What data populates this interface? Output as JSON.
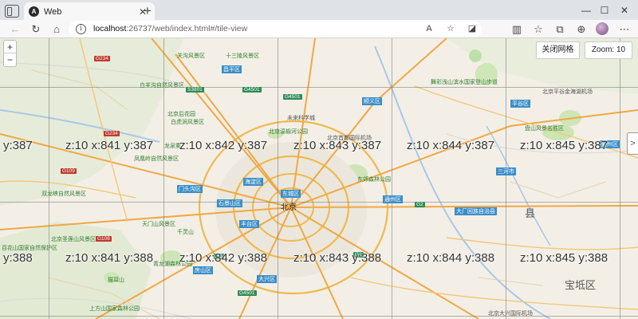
{
  "browser": {
    "tab": {
      "title": "Web",
      "favicon_letter": "A"
    },
    "address": {
      "host": "localhost",
      "rest": ":26737/web/index.html#/tile-view"
    },
    "reader_label": "A"
  },
  "map": {
    "controls": {
      "zoom_in": "+",
      "zoom_out": "−"
    },
    "grid_button": "关闭网格",
    "zoom_badge": "Zoom: 10",
    "tiles": [
      {
        "text": "y:387"
      },
      {
        "text": "z:10 x:841 y:387"
      },
      {
        "text": "z:10 x:842 y:387"
      },
      {
        "text": "z:10 x:843 y:387"
      },
      {
        "text": "z:10 x:844 y:387"
      },
      {
        "text": "z:10 x:845 y:387"
      },
      {
        "text": "y:388"
      },
      {
        "text": "z:10 x:841 y:388"
      },
      {
        "text": "z:10 x:842 y:388"
      },
      {
        "text": "z:10 x:843 y:388"
      },
      {
        "text": "z:10 x:844 y:388"
      },
      {
        "text": "z:10 x:845 y:388"
      }
    ],
    "places": [
      {
        "text": "关沟风景区",
        "cls": "park"
      },
      {
        "text": "十三陵风景区",
        "cls": "park"
      },
      {
        "text": "白羊沟自然风景区",
        "cls": "park"
      },
      {
        "text": "北京后花园",
        "cls": "park"
      },
      {
        "text": "白虎涧风景区",
        "cls": "park"
      },
      {
        "text": "龙泉雾",
        "cls": "park"
      },
      {
        "text": "凤凰岭自然风景区",
        "cls": "park"
      },
      {
        "text": "双龙峡自然风景区",
        "cls": "park"
      },
      {
        "text": "百花山国家自然保护区",
        "cls": "park"
      },
      {
        "text": "北京圣莲山风景区",
        "cls": "park"
      },
      {
        "text": "天门山风景区",
        "cls": "park"
      },
      {
        "text": "千灵山",
        "cls": "park"
      },
      {
        "text": "猫耳山",
        "cls": "park"
      },
      {
        "text": "上方山国家森林公园",
        "cls": "park"
      },
      {
        "text": "未来科学城",
        "cls": ""
      },
      {
        "text": "北京温榆河公园",
        "cls": "park"
      },
      {
        "text": "北京首都国际机场",
        "cls": ""
      },
      {
        "text": "北京大兴国际机场",
        "cls": ""
      },
      {
        "text": "东郊森林公园",
        "cls": "park"
      },
      {
        "text": "青龙湖森林公园",
        "cls": "park"
      },
      {
        "text": "北京",
        "cls": "city"
      },
      {
        "text": "县",
        "cls": "big"
      },
      {
        "text": "宝坻区",
        "cls": "big"
      },
      {
        "text": "大兴区",
        "cls": ""
      },
      {
        "text": "大厂回族自治县",
        "cls": ""
      },
      {
        "text": "盘山风景名胜区",
        "cls": "park"
      },
      {
        "text": "舞彩浅山滨水国家登山步道",
        "cls": "park"
      },
      {
        "text": "北京平谷金海湖机场",
        "cls": ""
      },
      {
        "text": "平谷区",
        "cls": ""
      },
      {
        "text": "通州区",
        "cls": ""
      },
      {
        "text": "顺义区",
        "cls": ""
      },
      {
        "text": "昌平区",
        "cls": ""
      },
      {
        "text": "门头沟区",
        "cls": ""
      },
      {
        "text": "海淀区",
        "cls": ""
      },
      {
        "text": "石景山区",
        "cls": ""
      },
      {
        "text": "丰台区",
        "cls": ""
      },
      {
        "text": "东城区",
        "cls": ""
      },
      {
        "text": "房山区",
        "cls": ""
      },
      {
        "text": "三河市",
        "cls": ""
      },
      {
        "text": "蓟州区",
        "cls": ""
      }
    ],
    "shields": [
      "G234",
      "G234",
      "G109",
      "G108",
      "G4501",
      "G4501",
      "S3801",
      "G6",
      "G1",
      "G4501",
      "G2"
    ]
  }
}
